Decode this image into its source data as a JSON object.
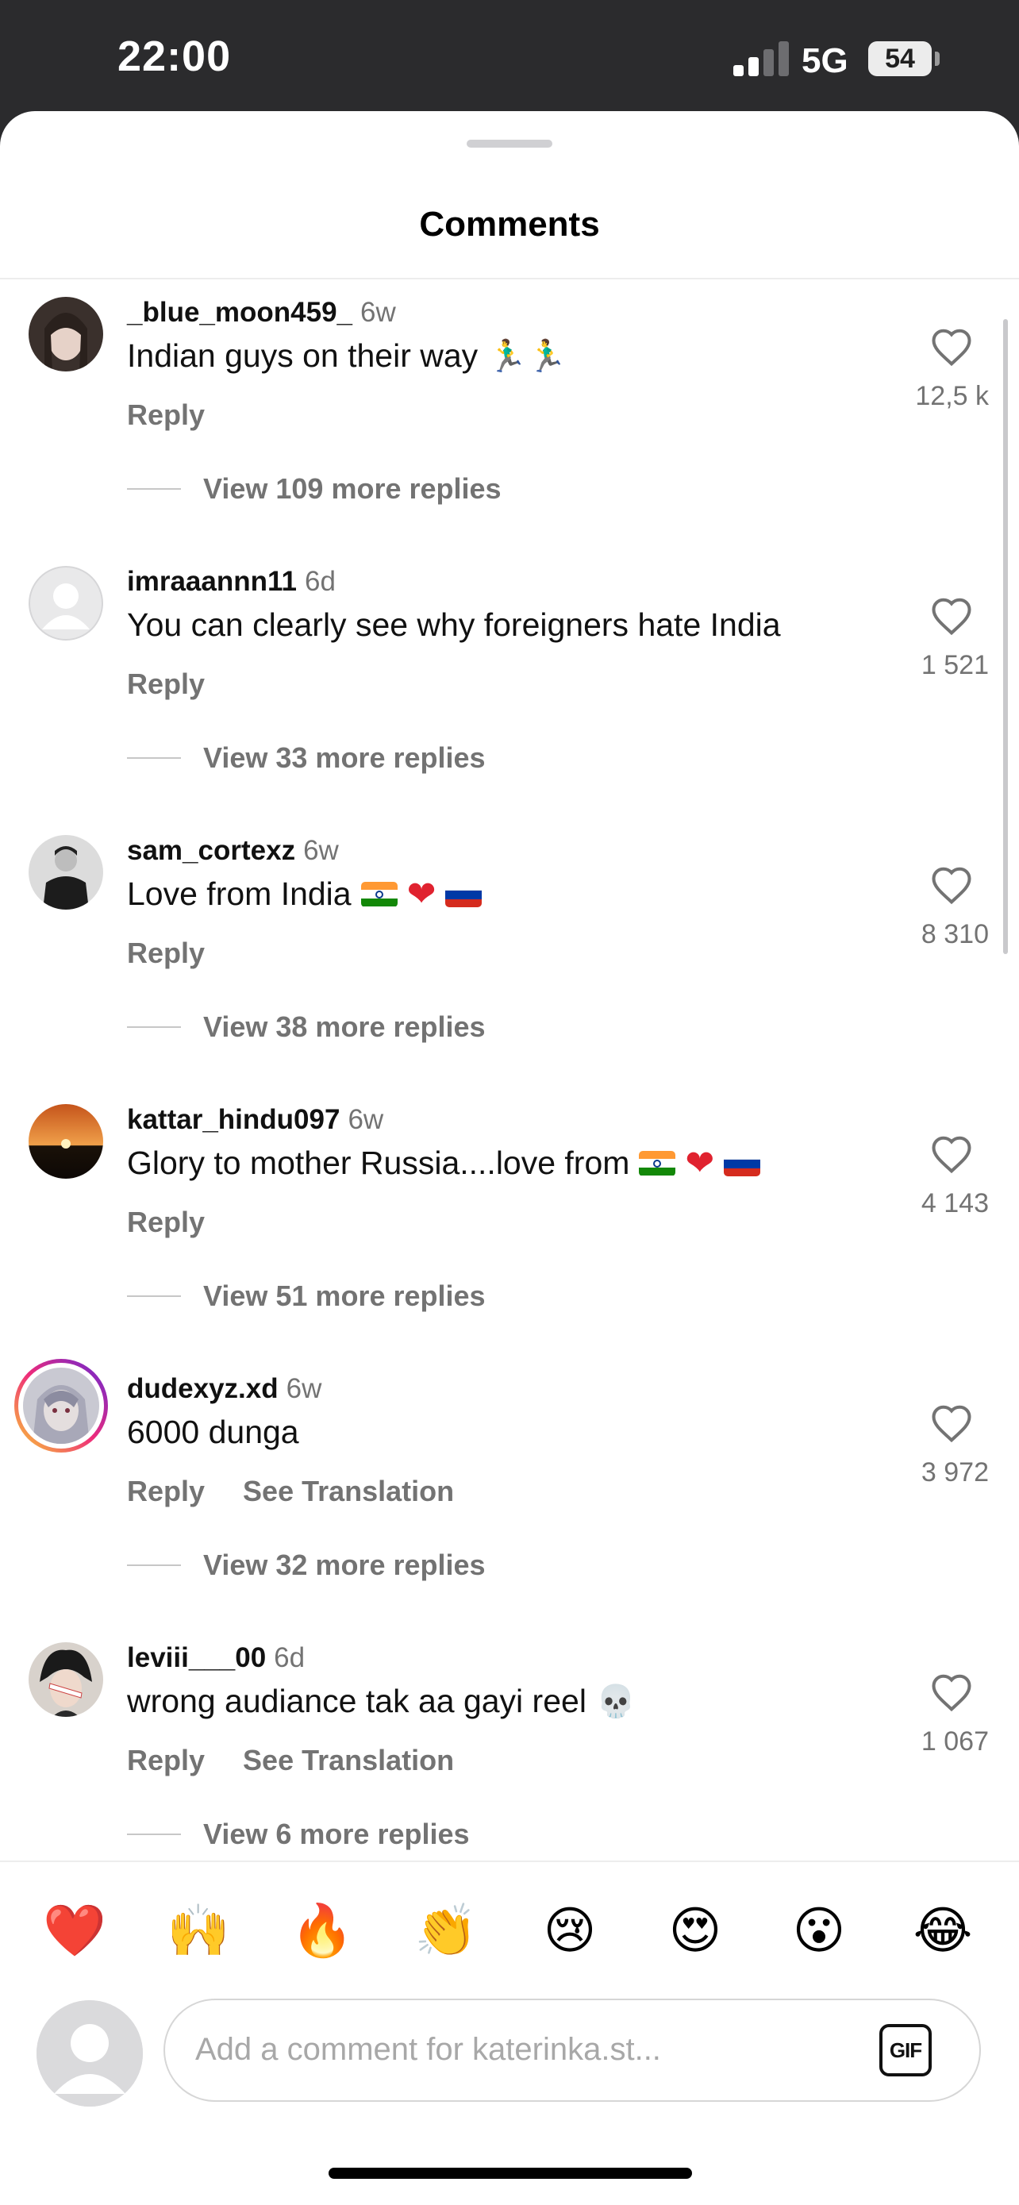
{
  "status_bar": {
    "time": "22:00",
    "network": "5G",
    "battery": "54"
  },
  "sheet": {
    "title": "Comments"
  },
  "comments": [
    {
      "username": "_blue_moon459_",
      "time": "6w",
      "text": "Indian guys on their way",
      "emojis": "🏃‍♂️🏃‍♂️",
      "reply": "Reply",
      "likes": "12,5 k",
      "view_replies": "View 109 more replies"
    },
    {
      "username": "imraaannn11",
      "time": "6d",
      "text": "You can clearly see why foreigners hate India",
      "reply": "Reply",
      "likes": "1 521",
      "view_replies": "View 33 more replies"
    },
    {
      "username": "sam_cortexz",
      "time": "6w",
      "text": "Love from India",
      "reply": "Reply",
      "likes": "8 310",
      "view_replies": "View 38 more replies"
    },
    {
      "username": "kattar_hindu097",
      "time": "6w",
      "text": "Glory to mother Russia....love from",
      "reply": "Reply",
      "likes": "4 143",
      "view_replies": "View 51 more replies"
    },
    {
      "username": "dudexyz.xd",
      "time": "6w",
      "text": "6000 dunga",
      "reply": "Reply",
      "see_translation": "See Translation",
      "likes": "3 972",
      "view_replies": "View 32 more replies"
    },
    {
      "username": "leviii___00",
      "time": "6d",
      "text": "wrong audiance tak aa gayi reel",
      "emojis": "💀",
      "reply": "Reply",
      "see_translation": "See Translation",
      "likes": "1 067",
      "view_replies": "View 6 more replies"
    }
  ],
  "reactions": [
    "❤️",
    "🙌",
    "🔥",
    "👏",
    "😢",
    "😍",
    "😮",
    "😂"
  ],
  "composer": {
    "placeholder": "Add a comment for katerinka.st...",
    "gif_label": "GIF"
  },
  "colors": {
    "accent_secondary_text": "#737373",
    "heart_red": "#e0222f",
    "story_ring_start": "#f9ce34",
    "story_ring_end": "#6228d7"
  }
}
